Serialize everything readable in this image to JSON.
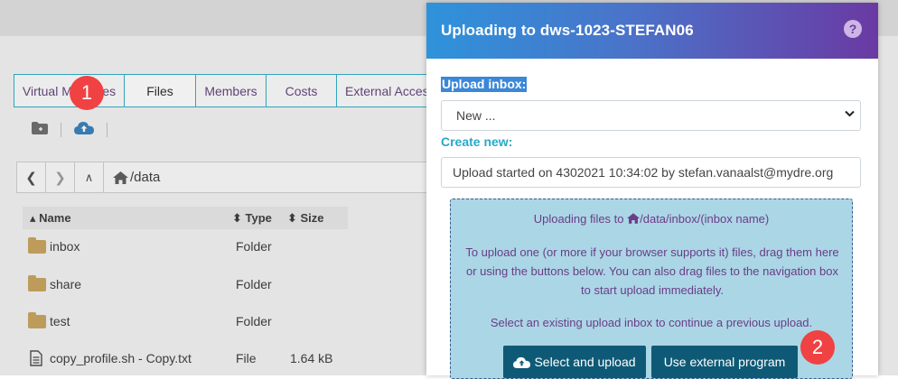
{
  "tabs": [
    "Virtual Machines",
    "Files",
    "Members",
    "Costs",
    "External Access"
  ],
  "toolbar": {
    "new_folder_icon": "folder-plus-icon",
    "upload_icon": "cloud-upload-icon"
  },
  "navigation": {
    "path": "/data"
  },
  "file_table": {
    "headers": {
      "name": "Name",
      "type": "Type",
      "size": "Size"
    },
    "rows": [
      {
        "name": "inbox",
        "type": "Folder",
        "size": ""
      },
      {
        "name": "share",
        "type": "Folder",
        "size": ""
      },
      {
        "name": "test",
        "type": "Folder",
        "size": ""
      },
      {
        "name": "copy_profile.sh - Copy.txt",
        "type": "File",
        "size": "1.64 kB"
      }
    ]
  },
  "modal": {
    "title": "Uploading to dws-1023-STEFAN06",
    "help": "?",
    "upload_inbox_label": "Upload inbox:",
    "select_value": "New ...",
    "create_new_label": "Create new:",
    "create_new_value": "Upload started on 4302021 10:34:02  by stefan.vanaalst@mydre.org",
    "dropzone": {
      "line1_prefix": "Uploading files to ",
      "line1_path": "/data/inbox/(inbox name)",
      "para": "To upload one (or more if your browser supports it) files, drag them here or using the buttons below. You can also drag files to the navigation box to start upload immediately.",
      "line3": "Select an existing upload inbox to continue a previous upload."
    },
    "buttons": {
      "select_upload": "Select and upload",
      "external": "Use external program"
    }
  },
  "badges": [
    "1",
    "2"
  ],
  "colors": {
    "accent": "#27a9c7",
    "header_start": "#2e93db",
    "header_end": "#6a3aa3",
    "button": "#0e5a76",
    "badge": "#f04242"
  }
}
